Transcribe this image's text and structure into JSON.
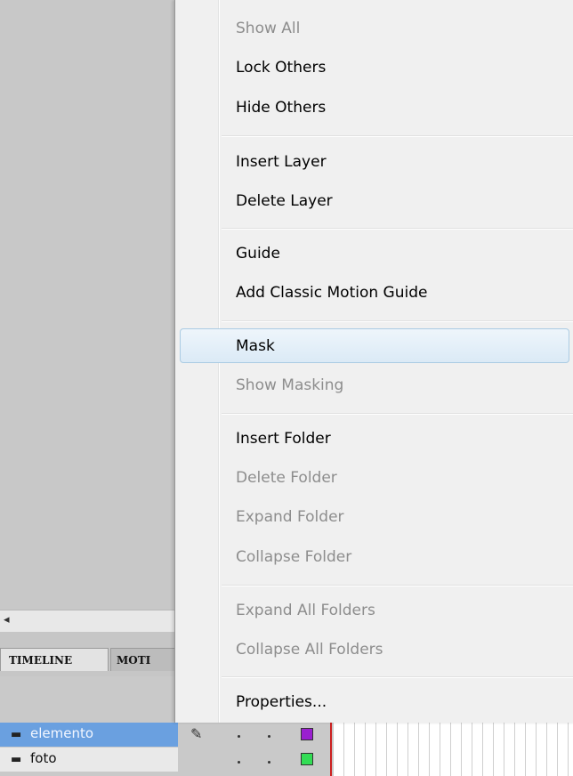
{
  "menu": {
    "items": [
      {
        "label": "Show All",
        "enabled": false
      },
      {
        "label": "Lock Others",
        "enabled": true
      },
      {
        "label": "Hide Others",
        "enabled": true
      },
      {
        "label": "Insert Layer",
        "enabled": true
      },
      {
        "label": "Delete Layer",
        "enabled": true
      },
      {
        "label": "Guide",
        "enabled": true
      },
      {
        "label": "Add Classic Motion Guide",
        "enabled": true
      },
      {
        "label": "Mask",
        "enabled": true,
        "highlighted": true
      },
      {
        "label": "Show Masking",
        "enabled": false
      },
      {
        "label": "Insert Folder",
        "enabled": true
      },
      {
        "label": "Delete Folder",
        "enabled": false
      },
      {
        "label": "Expand Folder",
        "enabled": false
      },
      {
        "label": "Collapse Folder",
        "enabled": false
      },
      {
        "label": "Expand All Folders",
        "enabled": false
      },
      {
        "label": "Collapse All Folders",
        "enabled": false
      },
      {
        "label": "Properties...",
        "enabled": true
      }
    ]
  },
  "panel": {
    "tabs": [
      "TIMELINE",
      "MOTI"
    ],
    "scroll_arrow": "◂"
  },
  "layers": [
    {
      "name": "elemento",
      "selected": true,
      "color": "#9a1fd0",
      "icon": "layer-icon"
    },
    {
      "name": "foto",
      "selected": false,
      "color": "#33dd55",
      "icon": "layer-icon"
    }
  ],
  "colors": {
    "selection_blue": "#6aa0e0",
    "menu_bg": "#f0f0f0",
    "highlight_border": "#aacbe3",
    "playhead": "#cc2020"
  }
}
